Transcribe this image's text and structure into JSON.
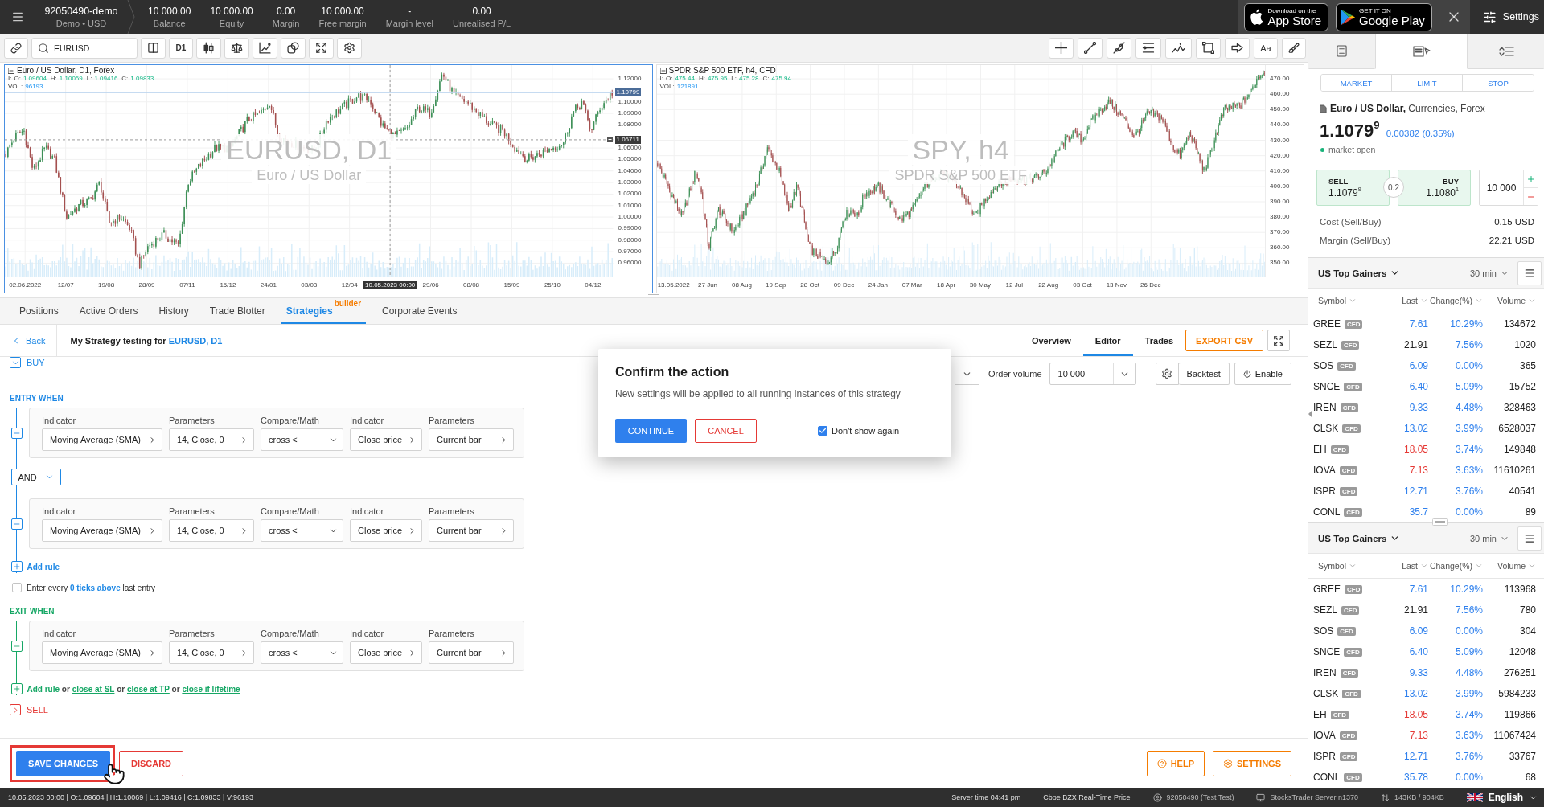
{
  "top_bar": {
    "account": {
      "id": "92050490-demo",
      "subtitle": "Demo • USD"
    },
    "stats": [
      {
        "value": "10 000.00",
        "label": "Balance"
      },
      {
        "value": "10 000.00",
        "label": "Equity"
      },
      {
        "value": "0.00",
        "label": "Margin"
      },
      {
        "value": "10 000.00",
        "label": "Free margin"
      },
      {
        "value": "-",
        "label": "Margin level"
      },
      {
        "value": "0.00",
        "label": "Unrealised P/L"
      }
    ],
    "store_badges": [
      {
        "kind": "apple",
        "caption": "Download on the",
        "store": "App Store"
      },
      {
        "kind": "google",
        "caption": "GET IT ON",
        "store": "Google Play"
      }
    ],
    "settings": "Settings"
  },
  "chart_toolbar": {
    "symbol": "EURUSD",
    "timeframe": "D1",
    "text_tool": "Aa"
  },
  "charts": [
    {
      "selected": true,
      "title": "Euro / US Dollar, D1, Forex",
      "prefix": "I:",
      "ohlc": [
        {
          "label": "O:",
          "value": "1.09604"
        },
        {
          "label": "H:",
          "value": "1.10069"
        },
        {
          "label": "L:",
          "value": "1.09416"
        },
        {
          "label": "C:",
          "value": "1.09833"
        }
      ],
      "volume_label": "VOL:",
      "volume": "96193",
      "watermark": "EURUSD, D1",
      "watermark_subtitle": "Euro / US Dollar",
      "price_ticks": [
        "1.12000",
        "1.10000",
        "1.09000",
        "1.08000",
        "1.06000",
        "1.05000",
        "1.04000",
        "1.03000",
        "1.02000",
        "1.01000",
        "1.00000",
        "0.99000",
        "0.98000",
        "0.97000",
        "0.96000"
      ],
      "current_price": "1.10799",
      "crosshair_price": "1.06711",
      "time_ticks": [
        {
          "kind": "date",
          "label": "02.06.2022"
        },
        {
          "kind": "date",
          "label": "12/07"
        },
        {
          "kind": "date",
          "label": "19/08"
        },
        {
          "kind": "date",
          "label": "28/09"
        },
        {
          "kind": "date",
          "label": "07/11"
        },
        {
          "kind": "date",
          "label": "15/12"
        },
        {
          "kind": "date",
          "label": "24/01"
        },
        {
          "kind": "date",
          "label": "03/03"
        },
        {
          "kind": "date",
          "label": "12/04"
        },
        {
          "kind": "crosshair",
          "label": "10.05.2023 00:00"
        },
        {
          "kind": "date",
          "label": "29/06"
        },
        {
          "kind": "date",
          "label": "08/08"
        },
        {
          "kind": "date",
          "label": "15/09"
        },
        {
          "kind": "date",
          "label": "25/10"
        },
        {
          "kind": "date",
          "label": "04/12"
        }
      ]
    },
    {
      "selected": false,
      "title": "SPDR S&P 500 ETF, h4, CFD",
      "prefix": "I:",
      "ohlc": [
        {
          "label": "O:",
          "value": "475.44"
        },
        {
          "label": "H:",
          "value": "475.95"
        },
        {
          "label": "L:",
          "value": "475.28"
        },
        {
          "label": "C:",
          "value": "475.94"
        }
      ],
      "volume_label": "VOL:",
      "volume": "121891",
      "watermark": "SPY, h4",
      "watermark_subtitle": "SPDR S&P 500 ETF",
      "price_ticks": [
        "470.00",
        "460.00",
        "450.00",
        "440.00",
        "430.00",
        "420.00",
        "410.00",
        "400.00",
        "390.00",
        "380.00",
        "370.00",
        "360.00",
        "350.00"
      ],
      "time_ticks": [
        {
          "kind": "date",
          "label": "13.05.2022"
        },
        {
          "kind": "date",
          "label": "27 Jun"
        },
        {
          "kind": "date",
          "label": "08 Aug"
        },
        {
          "kind": "date",
          "label": "19 Sep"
        },
        {
          "kind": "date",
          "label": "28 Oct"
        },
        {
          "kind": "date",
          "label": "09 Dec"
        },
        {
          "kind": "date",
          "label": "24 Jan"
        },
        {
          "kind": "date",
          "label": "07 Mar"
        },
        {
          "kind": "date",
          "label": "18 Apr"
        },
        {
          "kind": "date",
          "label": "30 May"
        },
        {
          "kind": "date",
          "label": "12 Jul"
        },
        {
          "kind": "date",
          "label": "22 Aug"
        },
        {
          "kind": "date",
          "label": "03 Oct"
        },
        {
          "kind": "date",
          "label": "13 Nov"
        },
        {
          "kind": "date",
          "label": "26 Dec"
        }
      ]
    }
  ],
  "bottom_tabs": [
    {
      "label": "Positions",
      "selected": false
    },
    {
      "label": "Active Orders",
      "selected": false
    },
    {
      "label": "History",
      "selected": false
    },
    {
      "label": "Trade Blotter",
      "selected": false
    },
    {
      "label": "Strategies",
      "selected": true,
      "badge": "builder"
    },
    {
      "label": "Corporate Events",
      "selected": false
    }
  ],
  "strategy": {
    "back": "Back",
    "title": "My Strategy testing for",
    "instrument": "EURUSD, D1",
    "views": [
      {
        "label": "Overview",
        "selected": false
      },
      {
        "label": "Editor",
        "selected": true
      },
      {
        "label": "Trades",
        "selected": false
      }
    ],
    "export": "EXPORT CSV",
    "buy": {
      "label": "BUY",
      "expanded": true
    },
    "order_volume": {
      "label": "Order volume",
      "value": "10 000"
    },
    "backtest": "Backtest",
    "enable": "Enable",
    "entry": {
      "title": "ENTRY WHEN",
      "rules": [
        {
          "fields": [
            {
              "label": "Indicator",
              "value": "Moving Average (SMA)",
              "kind": "picker"
            },
            {
              "label": "Parameters",
              "value": "14, Close, 0",
              "kind": "picker"
            },
            {
              "label": "Compare/Math",
              "value": "cross <",
              "kind": "select"
            },
            {
              "label": "Indicator",
              "value": "Close price",
              "kind": "picker"
            },
            {
              "label": "Parameters",
              "value": "Current bar",
              "kind": "picker"
            }
          ]
        },
        {
          "fields": [
            {
              "label": "Indicator",
              "value": "Moving Average (SMA)",
              "kind": "picker"
            },
            {
              "label": "Parameters",
              "value": "14, Close, 0",
              "kind": "picker"
            },
            {
              "label": "Compare/Math",
              "value": "cross <",
              "kind": "select"
            },
            {
              "label": "Indicator",
              "value": "Close price",
              "kind": "picker"
            },
            {
              "label": "Parameters",
              "value": "Current bar",
              "kind": "picker"
            }
          ]
        }
      ],
      "connectors": [
        "AND"
      ],
      "add_rule": "Add rule"
    },
    "repeat_entry": {
      "checked": false,
      "before": "Enter every",
      "link": "0 ticks above",
      "after": "last entry"
    },
    "exit": {
      "title": "EXIT WHEN",
      "rules": [
        {
          "fields": [
            {
              "label": "Indicator",
              "value": "Moving Average (SMA)",
              "kind": "picker"
            },
            {
              "label": "Parameters",
              "value": "14, Close, 0",
              "kind": "picker"
            },
            {
              "label": "Compare/Math",
              "value": "cross <",
              "kind": "select"
            },
            {
              "label": "Indicator",
              "value": "Close price",
              "kind": "picker"
            },
            {
              "label": "Parameters",
              "value": "Current bar",
              "kind": "picker"
            }
          ]
        }
      ],
      "actions": [
        {
          "kind": "action",
          "text": "Add rule"
        },
        {
          "kind": "word",
          "text": "or"
        },
        {
          "kind": "option",
          "text": "close at SL"
        },
        {
          "kind": "word",
          "text": "or"
        },
        {
          "kind": "option",
          "text": "close at TP"
        },
        {
          "kind": "word",
          "text": "or"
        },
        {
          "kind": "option",
          "text": "close if lifetime"
        }
      ]
    },
    "sell": {
      "label": "SELL",
      "expanded": false
    },
    "footer": {
      "save": "SAVE CHANGES",
      "discard": "DISCARD",
      "help": "HELP",
      "settings": "SETTINGS"
    }
  },
  "dialog": {
    "title": "Confirm the action",
    "message": "New settings will be applied to all running instances of this strategy",
    "confirm": "CONTINUE",
    "cancel": "CANCEL",
    "dont_show_again": {
      "label": "Don't show again",
      "checked": true
    }
  },
  "order_panel": {
    "tabs": [
      {
        "kind": "quotes",
        "selected": false
      },
      {
        "kind": "order",
        "selected": true
      },
      {
        "kind": "sort",
        "selected": false
      }
    ],
    "order_types": [
      "MARKET",
      "LIMIT",
      "STOP"
    ],
    "instrument": "**Euro / US Dollar,** Currencies, Forex",
    "price": "1.1079$^{9}$",
    "change": "0.00382 (0.35%)",
    "market_status": "market open",
    "sell": {
      "label": "SELL",
      "price": "1.1079$^{9}$"
    },
    "spread": "0.2",
    "buy": {
      "label": "BUY",
      "price": "1.1080$^{1}$"
    },
    "quantity": "10 000",
    "costs": [
      {
        "label": "Cost (Sell/Buy)",
        "value": "0.15 USD"
      },
      {
        "label": "Margin (Sell/Buy)",
        "value": "22.21 USD"
      }
    ]
  },
  "watchlists": [
    {
      "title": "US Top Gainers",
      "period": "30 min",
      "columns": [
        "Symbol",
        "Last",
        "Change(%)",
        "Volume"
      ],
      "rows": [
        {
          "symbol": "GREE",
          "tag": "CFD",
          "last": "7.61",
          "color": "#2f80ed",
          "change": "10.29%",
          "volume": "134672"
        },
        {
          "symbol": "SEZL",
          "tag": "CFD",
          "last": "21.91",
          "color": "#222222",
          "change": "7.56%",
          "volume": "1020"
        },
        {
          "symbol": "SOS",
          "tag": "CFD",
          "last": "6.09",
          "color": "#2f80ed",
          "change": "0.00%",
          "volume": "365"
        },
        {
          "symbol": "SNCE",
          "tag": "CFD",
          "last": "6.40",
          "color": "#2f80ed",
          "change": "5.09%",
          "volume": "15752"
        },
        {
          "symbol": "IREN",
          "tag": "CFD",
          "last": "9.33",
          "color": "#2f80ed",
          "change": "4.48%",
          "volume": "328463"
        },
        {
          "symbol": "CLSK",
          "tag": "CFD",
          "last": "13.02",
          "color": "#2f80ed",
          "change": "3.99%",
          "volume": "6528037"
        },
        {
          "symbol": "EH",
          "tag": "CFD",
          "last": "18.05",
          "color": "#e53935",
          "change": "3.74%",
          "volume": "149848"
        },
        {
          "symbol": "IOVA",
          "tag": "CFD",
          "last": "7.13",
          "color": "#e53935",
          "change": "3.63%",
          "volume": "11610261"
        },
        {
          "symbol": "ISPR",
          "tag": "CFD",
          "last": "12.71",
          "color": "#2f80ed",
          "change": "3.76%",
          "volume": "40541"
        },
        {
          "symbol": "CONL",
          "tag": "CFD",
          "last": "35.7",
          "color": "#2f80ed",
          "change": "0.00%",
          "volume": "89"
        }
      ]
    },
    {
      "title": "US Top Gainers",
      "period": "30 min",
      "columns": [
        "Symbol",
        "Last",
        "Change(%)",
        "Volume"
      ],
      "rows": [
        {
          "symbol": "GREE",
          "tag": "CFD",
          "last": "7.61",
          "color": "#2f80ed",
          "change": "10.29%",
          "volume": "113968"
        },
        {
          "symbol": "SEZL",
          "tag": "CFD",
          "last": "21.91",
          "color": "#222222",
          "change": "7.56%",
          "volume": "780"
        },
        {
          "symbol": "SOS",
          "tag": "CFD",
          "last": "6.09",
          "color": "#2f80ed",
          "change": "0.00%",
          "volume": "304"
        },
        {
          "symbol": "SNCE",
          "tag": "CFD",
          "last": "6.40",
          "color": "#2f80ed",
          "change": "5.09%",
          "volume": "12048"
        },
        {
          "symbol": "IREN",
          "tag": "CFD",
          "last": "9.33",
          "color": "#2f80ed",
          "change": "4.48%",
          "volume": "276251"
        },
        {
          "symbol": "CLSK",
          "tag": "CFD",
          "last": "13.02",
          "color": "#2f80ed",
          "change": "3.99%",
          "volume": "5984233"
        },
        {
          "symbol": "EH",
          "tag": "CFD",
          "last": "18.05",
          "color": "#e53935",
          "change": "3.74%",
          "volume": "119866"
        },
        {
          "symbol": "IOVA",
          "tag": "CFD",
          "last": "7.13",
          "color": "#e53935",
          "change": "3.63%",
          "volume": "11067424"
        },
        {
          "symbol": "ISPR",
          "tag": "CFD",
          "last": "12.71",
          "color": "#2f80ed",
          "change": "3.76%",
          "volume": "33767"
        },
        {
          "symbol": "CONL",
          "tag": "CFD",
          "last": "35.78",
          "color": "#2f80ed",
          "change": "0.00%",
          "volume": "68"
        }
      ]
    }
  ],
  "status_bar": {
    "quote": "10.05.2023 00:00 | O:1.09604 | H:1.10069 | L:1.09416 | C:1.09833 | V:96193",
    "server_time": "Server time 04:41 pm",
    "feed": "Cboe BZX Real-Time Price",
    "user": "92050490 (Test Test)",
    "server": "StocksTrader Server n1370",
    "traffic": "143KB / 904KB",
    "language": "English"
  }
}
